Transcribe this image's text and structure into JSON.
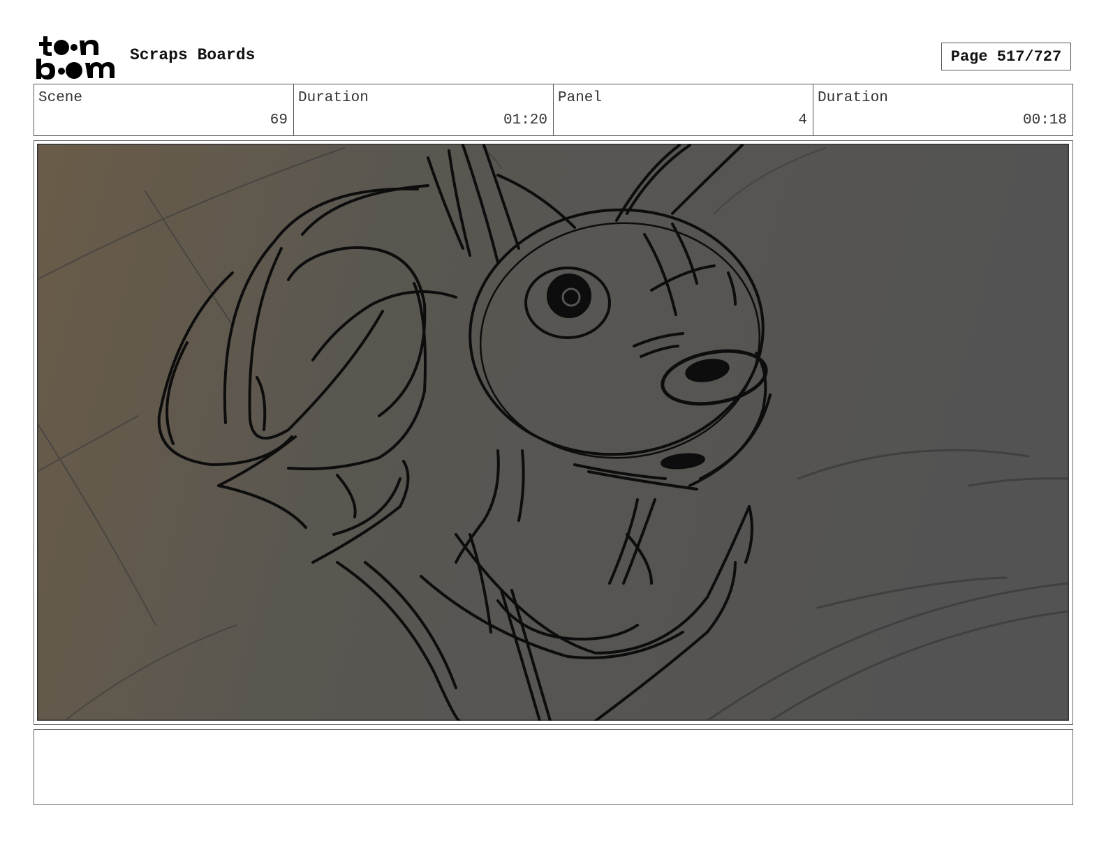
{
  "header": {
    "logo_text_top": "toon",
    "logo_text_bottom": "boom",
    "project_title": "Scraps Boards",
    "page_label": "Page 517/727"
  },
  "info": {
    "scene_label": "Scene",
    "scene_value": "69",
    "scene_duration_label": "Duration",
    "scene_duration_value": "01:20",
    "panel_label": "Panel",
    "panel_value": "4",
    "panel_duration_label": "Duration",
    "panel_duration_value": "00:18"
  },
  "notes": {
    "text": ""
  }
}
